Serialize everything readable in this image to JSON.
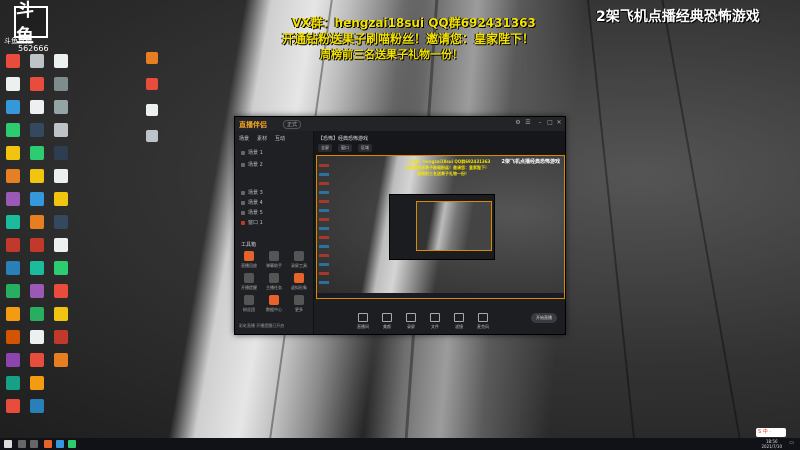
{
  "overlay": {
    "line1": "VX群：hengzai18sui QQ群692431363",
    "line2": "开通钻粉送果子刷喵粉丝！邀请您：皇家陛下！",
    "line3": "周榜前三名送果子礼物一份！",
    "stream_title": "2架飞机点播经典恐怖游戏"
  },
  "desktop": {
    "logo_text": "斗鱼",
    "logo_sub": "斗鱼直播",
    "room_number": "562666"
  },
  "app": {
    "brand": "直播伴侣",
    "version": "正式",
    "left_tabs": [
      "场景",
      "素材",
      "互动"
    ],
    "scenes": [
      "场景 1",
      "场景 2",
      "场景 3",
      "场景 4",
      "场景 5",
      "窗口 1"
    ],
    "tools_title": "工具箱",
    "tools": [
      "直播回放",
      "弹幕助手",
      "录屏工具",
      "开播提醒",
      "主播任务",
      "虚拟形象",
      "粉丝团",
      "数据中心",
      "更多"
    ],
    "bottom_notice": "彩虹直播  开播提醒已开启",
    "header_title": "【恐怖】经典恐怖游戏",
    "header_tabs": [
      "全屏",
      "窗口",
      "区域"
    ],
    "preview_title": "2架飞机点播经典恐怖游戏",
    "bottom_items": [
      "直播间",
      "美颜",
      "录屏",
      "文件",
      "滤镜",
      "麦克风"
    ],
    "start_button": "开始直播"
  },
  "taskbar": {
    "time": "18:56",
    "date": "2021/7/10"
  },
  "ime": {
    "label": "S 中 ·"
  },
  "colors": {
    "overlay_yellow": "#f4e300",
    "accent_orange": "#f5a623",
    "preview_border": "#d98a00"
  }
}
